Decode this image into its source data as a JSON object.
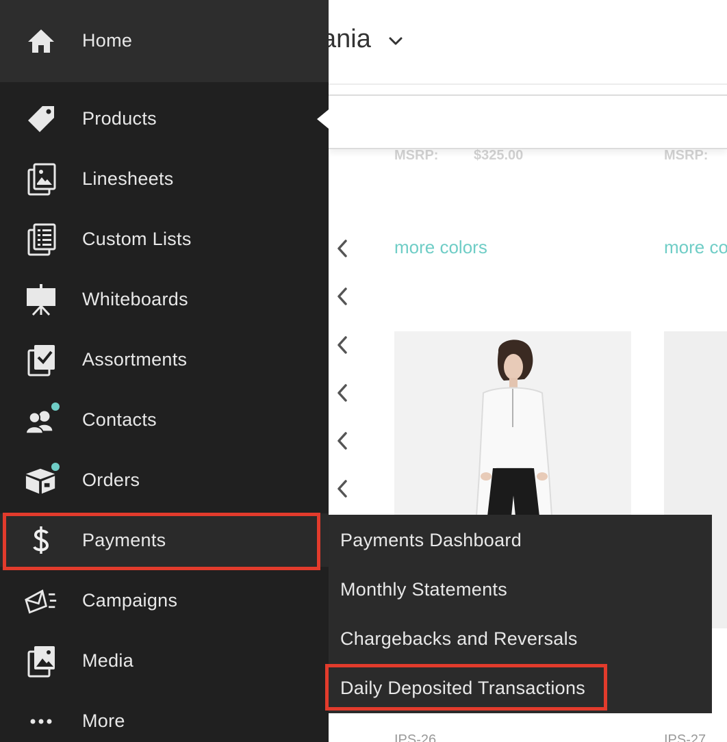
{
  "background": {
    "title_fragment": "ania",
    "msrp_label": "MSRP:",
    "msrp_value": "$325.00",
    "msrp_label_2": "MSRP:",
    "more_colors": "more colors",
    "more_colors_2": "more co",
    "sku_1": "IPS-26",
    "sku_2": "IPS-27"
  },
  "sidebar": {
    "items": [
      {
        "label": "Home",
        "icon": "home-icon"
      },
      {
        "label": "Products",
        "icon": "tag-icon"
      },
      {
        "label": "Linesheets",
        "icon": "linesheets-icon"
      },
      {
        "label": "Custom Lists",
        "icon": "list-icon"
      },
      {
        "label": "Whiteboards",
        "icon": "whiteboard-icon"
      },
      {
        "label": "Assortments",
        "icon": "assortment-icon"
      },
      {
        "label": "Contacts",
        "icon": "contacts-icon"
      },
      {
        "label": "Orders",
        "icon": "box-icon"
      },
      {
        "label": "Payments",
        "icon": "dollar-icon"
      },
      {
        "label": "Campaigns",
        "icon": "envelope-icon"
      },
      {
        "label": "Media",
        "icon": "media-icon"
      },
      {
        "label": "More",
        "icon": "ellipsis-icon"
      }
    ]
  },
  "submenu": {
    "items": [
      {
        "label": "Payments Dashboard"
      },
      {
        "label": "Monthly Statements"
      },
      {
        "label": "Chargebacks and Reversals"
      },
      {
        "label": "Daily Deposited Transactions"
      }
    ]
  },
  "colors": {
    "sidebar_bg": "#202020",
    "accent_teal": "#6fcdc6",
    "highlight_red": "#e23b2c"
  }
}
